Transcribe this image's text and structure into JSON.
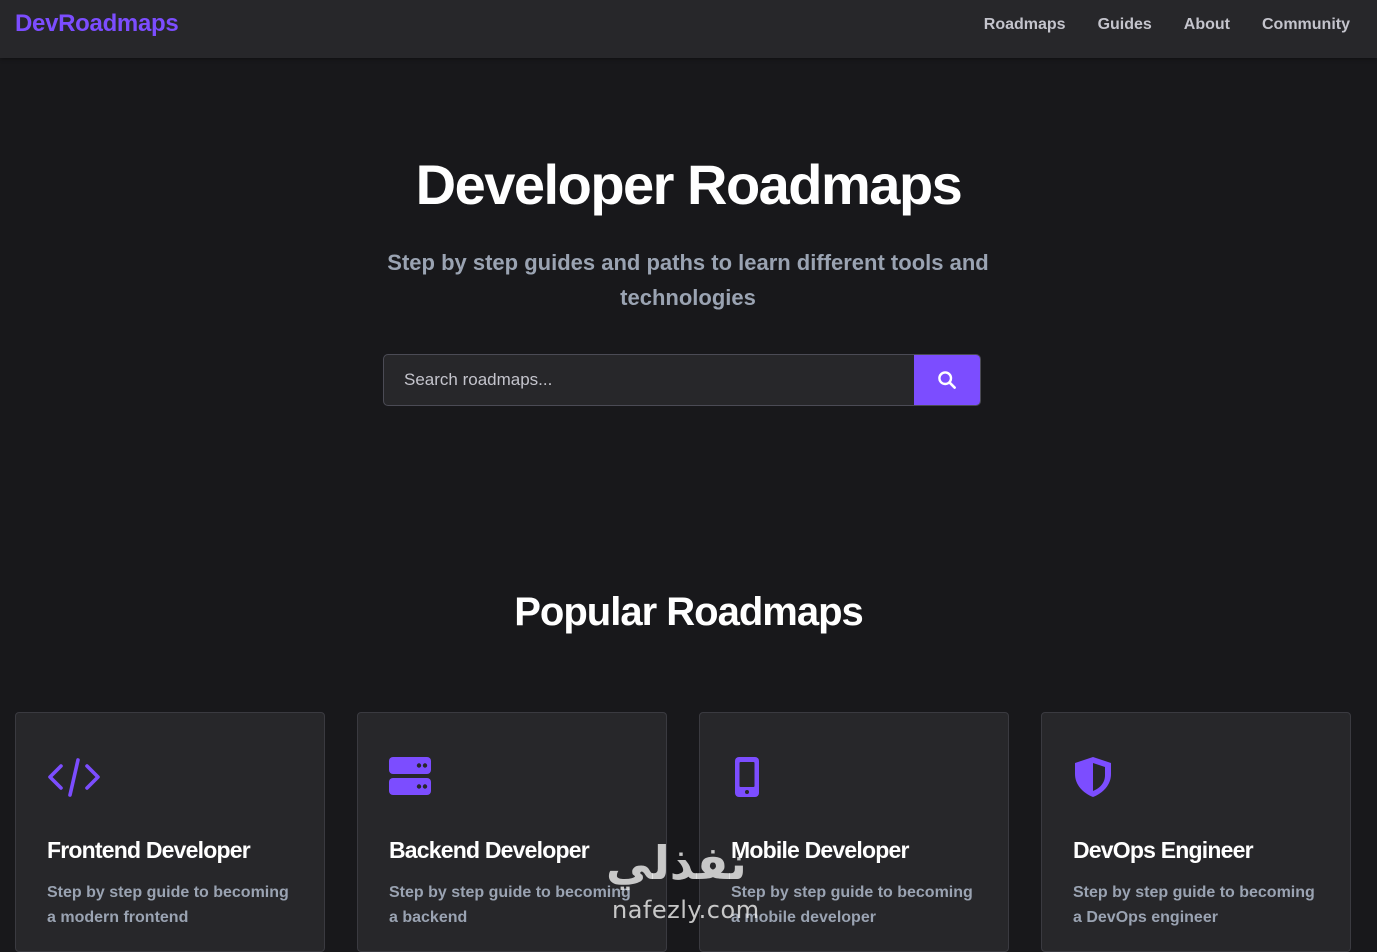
{
  "nav": {
    "brand": "DevRoadmaps",
    "links": [
      "Roadmaps",
      "Guides",
      "About",
      "Community"
    ]
  },
  "hero": {
    "title": "Developer Roadmaps",
    "subtitle": "Step by step guides and paths to learn different tools and technologies"
  },
  "search": {
    "placeholder": "Search roadmaps...",
    "value": "",
    "button_icon": "search-icon"
  },
  "popular": {
    "title": "Popular Roadmaps",
    "cards": [
      {
        "icon": "code-icon",
        "title": "Frontend Developer",
        "desc": "Step by step guide to becoming a modern frontend"
      },
      {
        "icon": "server-icon",
        "title": "Backend Developer",
        "desc": "Step by step guide to becoming a backend"
      },
      {
        "icon": "mobile-icon",
        "title": "Mobile Developer",
        "desc": "Step by step guide to becoming a mobile developer"
      },
      {
        "icon": "shield-icon",
        "title": "DevOps Engineer",
        "desc": "Step by step guide to becoming a DevOps engineer"
      }
    ]
  },
  "watermark": {
    "arabic": "نفذلي",
    "latin": "nafezly.com"
  },
  "colors": {
    "accent": "#7c4dff",
    "background": "#18181b",
    "surface": "#27272a",
    "muted_text": "#9aa3b2",
    "nav_text": "#c4c4cc"
  }
}
